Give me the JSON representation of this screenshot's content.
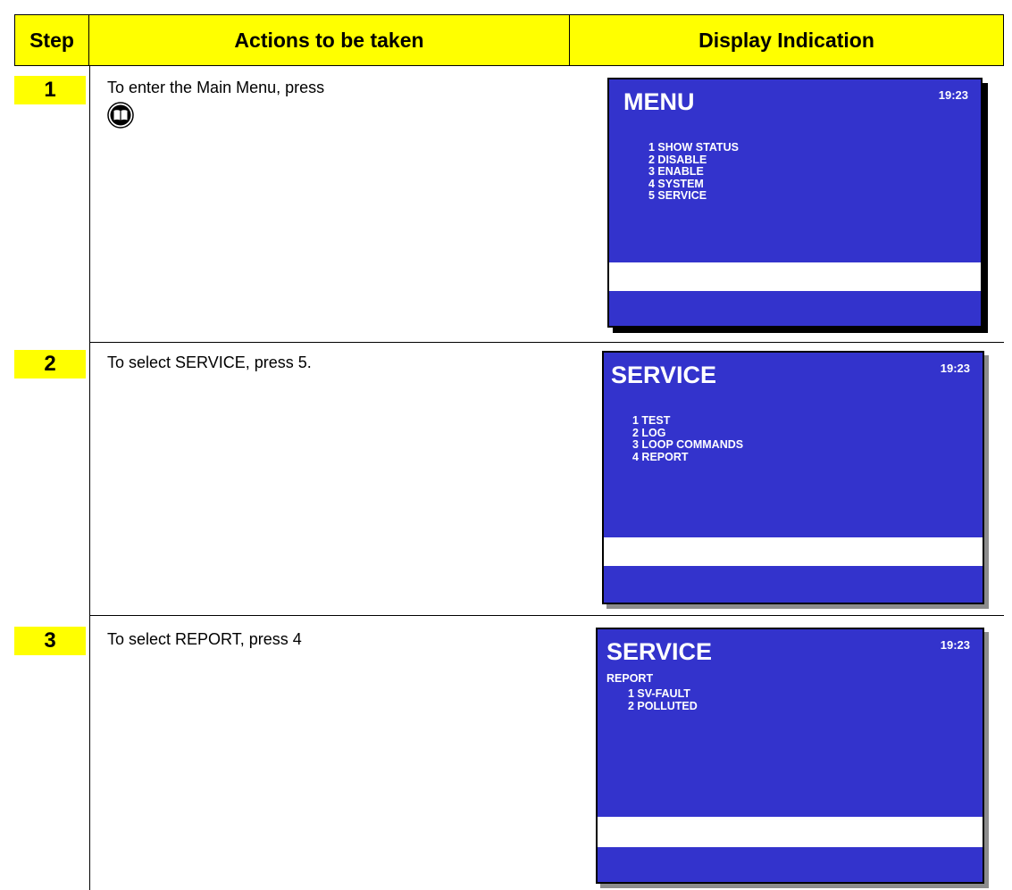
{
  "header": {
    "step": "Step",
    "actions": "Actions to be taken",
    "display": "Display Indication"
  },
  "rows": [
    {
      "step": "1",
      "action": "To enter the Main Menu, press",
      "icon": "menu-book-icon",
      "display": {
        "title": "MENU",
        "time": "19:23",
        "subtitle": "",
        "items": [
          "1 SHOW STATUS",
          "2 DISABLE",
          "3 ENABLE",
          "4 SYSTEM",
          "5 SERVICE"
        ]
      }
    },
    {
      "step": "2",
      "action": "To select SERVICE, press 5.",
      "display": {
        "title": "SERVICE",
        "time": "19:23",
        "subtitle": "",
        "items": [
          "1 TEST",
          "2 LOG",
          "3 LOOP COMMANDS",
          "4 REPORT"
        ]
      }
    },
    {
      "step": "3",
      "action": "To select REPORT, press 4",
      "display": {
        "title": "SERVICE",
        "time": "19:23",
        "subtitle": "REPORT",
        "items": [
          "1 SV-FAULT",
          "2 POLLUTED"
        ]
      }
    }
  ],
  "colors": {
    "header_bg": "#ffff00",
    "panel_bg": "#3333cc",
    "panel_text": "#ffffff",
    "bar": "#ffffff"
  }
}
